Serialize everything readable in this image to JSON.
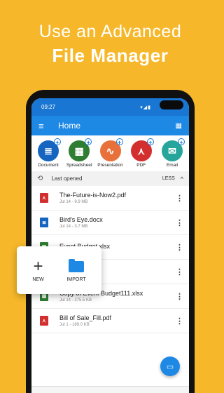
{
  "headline": {
    "line1": "Use an Advanced",
    "line2": "File Manager"
  },
  "status": {
    "time": "09:27",
    "icons": "▾◢▮"
  },
  "appbar": {
    "menu_icon": "≡",
    "title": "Home",
    "grid_icon": "▦"
  },
  "quick_actions": [
    {
      "label": "Document",
      "color": "#1565c0",
      "glyph": "≣"
    },
    {
      "label": "Spreadsheet",
      "color": "#2e7d32",
      "glyph": "▦"
    },
    {
      "label": "Presentation",
      "color": "#e8703a",
      "glyph": "∿"
    },
    {
      "label": "PDF",
      "color": "#d32f2f",
      "glyph": "⋏"
    },
    {
      "label": "Email",
      "color": "#26a69a",
      "glyph": "✉"
    }
  ],
  "section": {
    "title": "Last opened",
    "toggle": "LESS",
    "clock_icon": "⟲",
    "chevron": "^"
  },
  "files": [
    {
      "name": "The-Future-is-Now2.pdf",
      "meta": "Jul 14 - 9.9 MB",
      "type": "pdf",
      "color": "#d32f2f",
      "glyph": "⋏"
    },
    {
      "name": "Bird's Eye.docx",
      "meta": "Jul 14 - 3.7 MB",
      "type": "doc",
      "color": "#1565c0",
      "glyph": "≣"
    },
    {
      "name": "Event Budget.xlsx",
      "meta": "",
      "type": "xls",
      "color": "#2e7d32",
      "glyph": "▦"
    },
    {
      "name": "rland.pptx",
      "meta": "",
      "type": "ppt",
      "color": "#e8703a",
      "glyph": "∿"
    },
    {
      "name": "Copy of Event Budget111.xlsx",
      "meta": "Jul 14 - 275.5 KB",
      "type": "xls",
      "color": "#2e7d32",
      "glyph": "▦"
    },
    {
      "name": "Bill of Sale_Fill.pdf",
      "meta": "Jul 1 - 189.0 KB",
      "type": "pdf",
      "color": "#d32f2f",
      "glyph": "⋏"
    }
  ],
  "more_icon": "⋮",
  "fab_icon": "▭",
  "popup": {
    "new_label": "NEW",
    "new_icon": "+",
    "import_label": "IMPORT"
  }
}
